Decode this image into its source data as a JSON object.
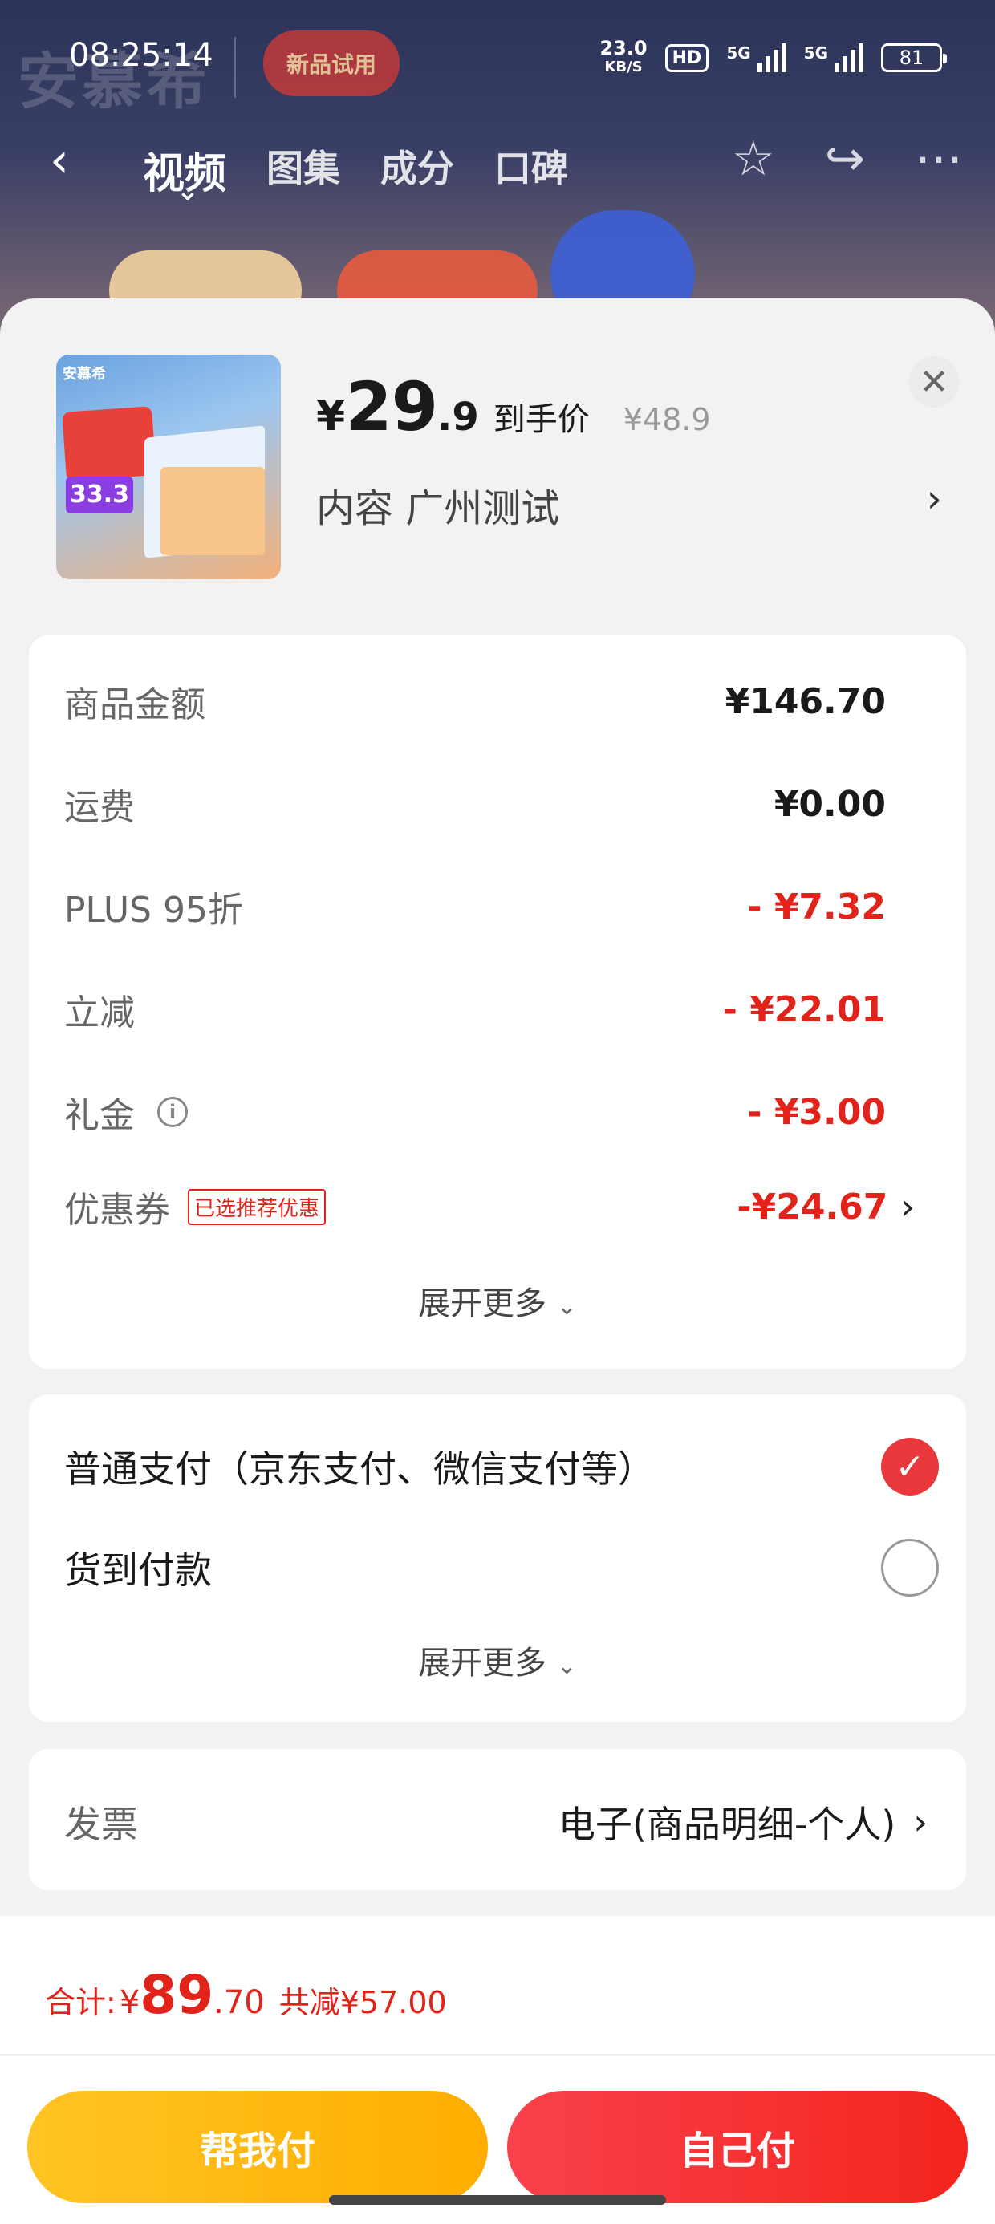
{
  "status_bar": {
    "time": "08:25:14",
    "net_speed_value": "23.0",
    "net_speed_unit": "KB/S",
    "hd": "HD",
    "sim1": "5G",
    "sim2": "5G",
    "battery": "81"
  },
  "background": {
    "brand": "安慕希",
    "sticker": "新品试用"
  },
  "nav": {
    "back_icon": "chevron-left",
    "tabs": [
      "视频",
      "图集",
      "成分",
      "口碑"
    ],
    "active_tab": "视频",
    "icons": [
      "star-icon",
      "share-icon",
      "more-icon"
    ]
  },
  "product": {
    "currency": "¥",
    "price_int": "29",
    "price_dec": ".9",
    "price_tag": "到手价",
    "original_price": "¥48.9",
    "spec": "内容  广州测试",
    "image_brand": "安慕希",
    "image_price": "33.3"
  },
  "amounts": {
    "rows": [
      {
        "label": "商品金额",
        "value": "¥146.70",
        "red": false
      },
      {
        "label": "运费",
        "value": "¥0.00",
        "red": false
      },
      {
        "label": "PLUS 95折",
        "value": "- ¥7.32",
        "red": true
      },
      {
        "label": "立减",
        "value": "- ¥22.01",
        "red": true
      },
      {
        "label": "礼金",
        "value": "- ¥3.00",
        "red": true
      },
      {
        "label": "优惠券",
        "value": "-¥24.67",
        "red": true
      }
    ],
    "coupon_badge": "已选推荐优惠",
    "expand": "展开更多"
  },
  "payment": {
    "options": [
      {
        "label": "普通支付（京东支付、微信支付等）",
        "selected": true
      },
      {
        "label": "货到付款",
        "selected": false
      }
    ],
    "expand": "展开更多"
  },
  "invoice": {
    "label": "发票",
    "value": "电子(商品明细-个人)"
  },
  "footer": {
    "total_label": "合计:",
    "total_cur": "¥",
    "total_int": "89",
    "total_dec": ".70",
    "total_save": "共减¥57.00",
    "btn_help": "帮我付",
    "btn_self": "自己付"
  },
  "colors": {
    "accent_red": "#e2231a",
    "button_yellow": "#ffb800",
    "button_red": "#f52f2a"
  }
}
